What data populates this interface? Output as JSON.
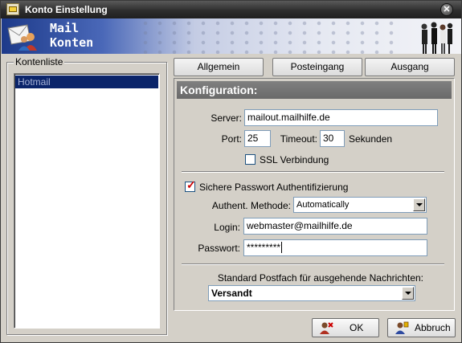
{
  "window": {
    "title": "Konto Einstellung",
    "close_icon": "close-icon"
  },
  "banner": {
    "line1": "Mail",
    "line2": "Konten"
  },
  "accounts": {
    "caption": "Kontenliste",
    "items": [
      "Hotmail"
    ]
  },
  "tabs": [
    "Allgemein",
    "Posteingang",
    "Ausgang"
  ],
  "config": {
    "header": "Konfiguration:",
    "server_label": "Server:",
    "server_value": "mailout.mailhilfe.de",
    "port_label": "Port:",
    "port_value": "25",
    "timeout_label": "Timeout:",
    "timeout_value": "30",
    "seconds_label": "Sekunden",
    "ssl_label": "SSL Verbindung",
    "ssl_checked": false,
    "auth_label": "Sichere Passwort Authentifizierung",
    "auth_checked": true,
    "method_label": "Authent. Methode:",
    "method_value": "Automatically",
    "login_label": "Login:",
    "login_value": "webmaster@mailhilfe.de",
    "password_label": "Passwort:",
    "password_value": "*********",
    "mailbox_label": "Standard Postfach für ausgehende Nachrichten:",
    "mailbox_value": "Versandt"
  },
  "buttons": {
    "ok": "OK",
    "cancel": "Abbruch"
  }
}
